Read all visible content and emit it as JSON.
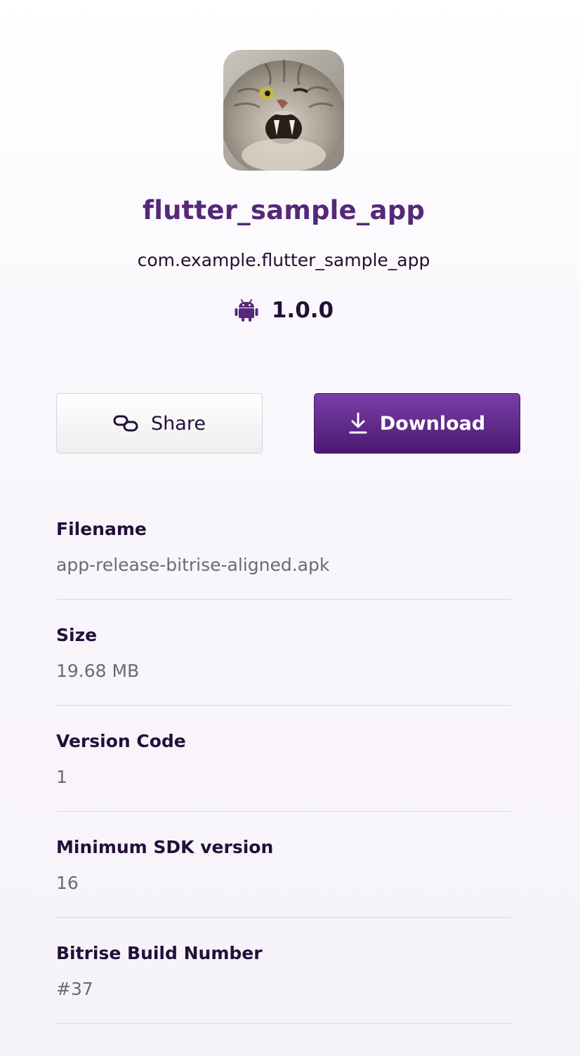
{
  "app": {
    "icon": "cat-photo-app-icon",
    "name": "flutter_sample_app",
    "bundle_id": "com.example.flutter_sample_app",
    "platform_icon": "android-icon",
    "version": "1.0.0"
  },
  "actions": {
    "share_label": "Share",
    "share_icon": "link-icon",
    "download_label": "Download",
    "download_icon": "download-icon"
  },
  "details": [
    {
      "label": "Filename",
      "value": "app-release-bitrise-aligned.apk"
    },
    {
      "label": "Size",
      "value": "19.68 MB"
    },
    {
      "label": "Version Code",
      "value": "1"
    },
    {
      "label": "Minimum SDK version",
      "value": "16"
    },
    {
      "label": "Bitrise Build Number",
      "value": "#37"
    }
  ],
  "colors": {
    "brand_purple": "#55287a",
    "download_button_top": "#7b3ea8",
    "download_button_bottom": "#4a1970",
    "text_dark": "#22103a",
    "text_muted": "#6e6874"
  }
}
